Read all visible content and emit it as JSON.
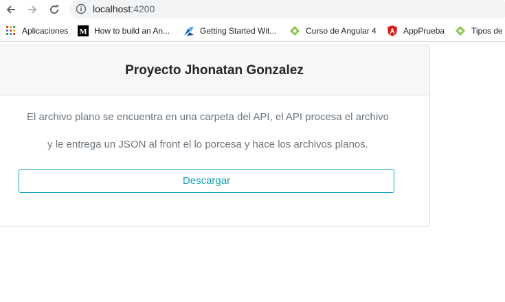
{
  "browser": {
    "url_host": "localhost",
    "url_port": ":4200"
  },
  "bookmarks": [
    {
      "label": "Aplicaciones",
      "icon": "apps-grid-icon"
    },
    {
      "label": "How to build an An...",
      "icon": "medium-logo-icon"
    },
    {
      "label": "Getting Started Wit...",
      "icon": "blue-logo-icon"
    },
    {
      "label": "Curso de Angular 4",
      "icon": "green-diamond-icon"
    },
    {
      "label": "AppPrueba",
      "icon": "angular-shield-icon"
    },
    {
      "label": "Tipos de",
      "icon": "green-diamond-icon"
    }
  ],
  "card": {
    "title": "Proyecto Jhonatan Gonzalez",
    "line1": "El archivo plano se encuentra en una carpeta del API, el API procesa el archivo",
    "line2": "y le entrega un JSON al front el lo porcesa y hace los archivos planos.",
    "button_label": "Descargar"
  },
  "colors": {
    "accent": "#17a2b8",
    "text_muted": "#6c757d",
    "header_bg": "#f7f7f7"
  }
}
